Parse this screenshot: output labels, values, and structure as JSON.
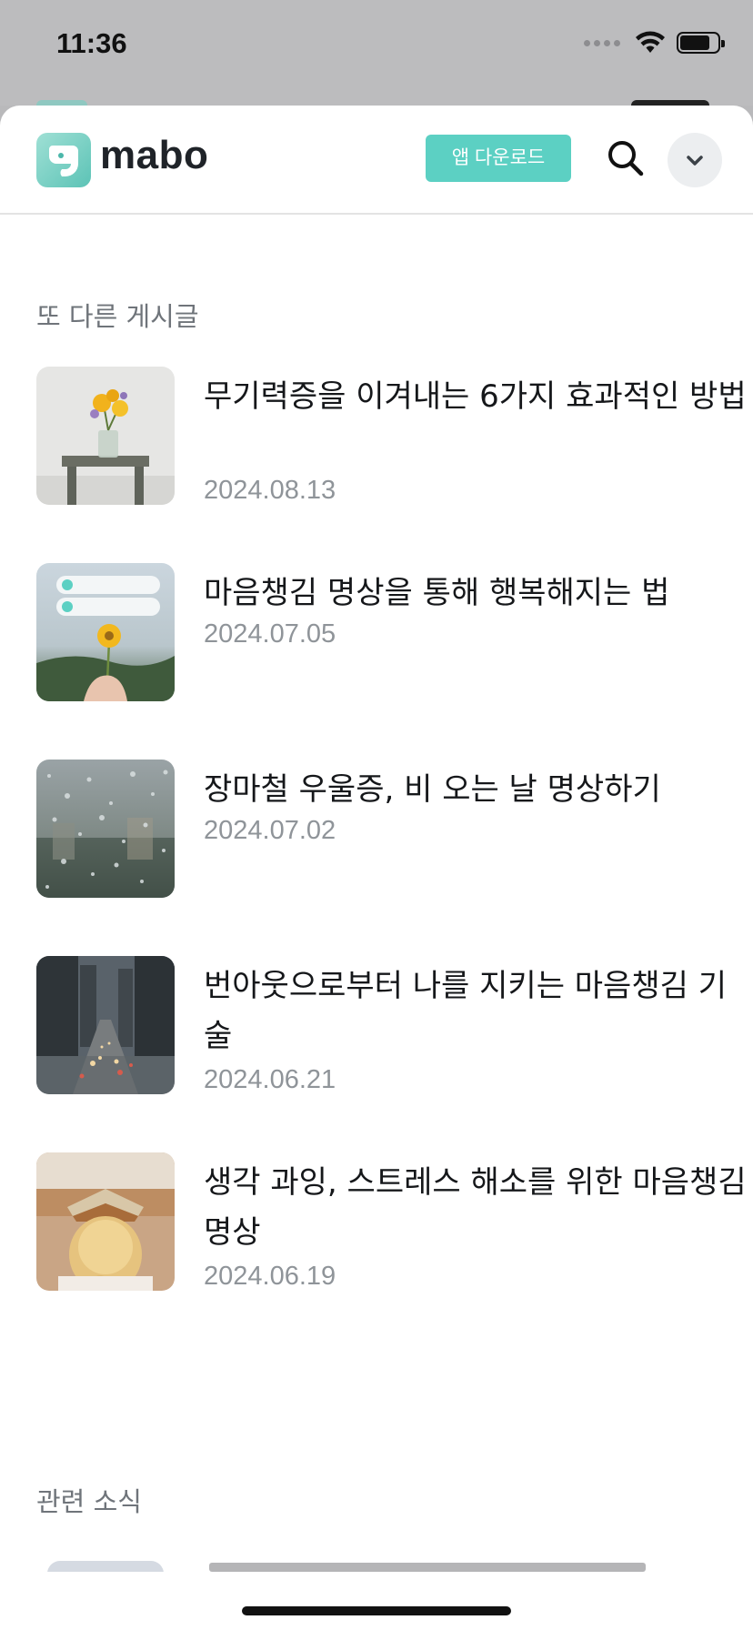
{
  "status_bar": {
    "time": "11:36",
    "battery_level": 0.8
  },
  "header": {
    "logo_text": "mabo",
    "app_download_label": "앱 다운로드"
  },
  "section_other": {
    "title": "또 다른 게시글",
    "items": [
      {
        "title": "무기력증을 이겨내는 6가지 효과적인 방법",
        "date": "2024.08.13"
      },
      {
        "title": "마음챙김 명상을 통해 행복해지는 법",
        "date": "2024.07.05"
      },
      {
        "title": "장마철 우울증, 비 오는 날 명상하기",
        "date": "2024.07.02"
      },
      {
        "title": "번아웃으로부터 나를 지키는 마음챙김 기술",
        "date": "2024.06.21"
      },
      {
        "title": "생각 과잉, 스트레스 해소를 위한 마음챙김 명상",
        "date": "2024.06.19"
      }
    ]
  },
  "section_news": {
    "title": "관련 소식"
  },
  "colors": {
    "accent": "#5cd0c3",
    "title_text": "#15171a",
    "date_text": "#8f9499"
  }
}
